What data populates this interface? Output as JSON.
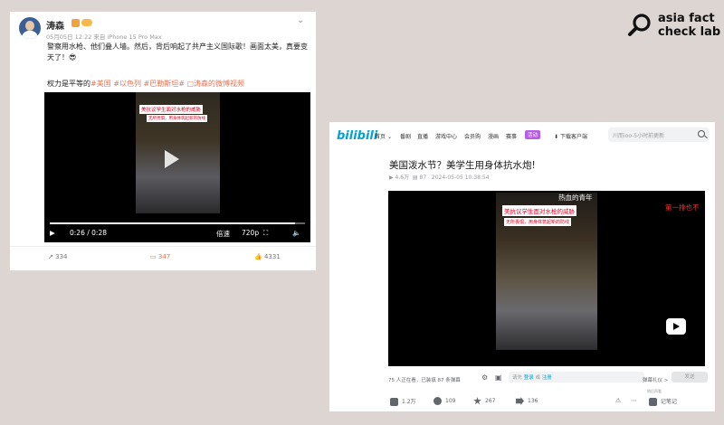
{
  "logo": {
    "line1": "asia fact",
    "line2": "check lab"
  },
  "weibo": {
    "username": "涛森",
    "meta": "05月05日 12:22 来自 iPhone 15 Pro Max",
    "text": "警察用水枪、他们叠人墙。然后，背后响起了共产主义国际歌！画面太美，真要变天了！😎",
    "lead": "权力是平等的",
    "tags": [
      "#美国",
      "#以色列",
      "#巴勒斯坦#",
      "涛森的微博视频"
    ],
    "video": {
      "caption1": "美抗议学生面对水枪的威胁",
      "caption2": "无所畏惧，用身体筑起新的防线",
      "current_time": "0:26",
      "total_time": "0:28",
      "separator": "/",
      "speed": "倍速",
      "quality": "720p",
      "progress": 0.96
    },
    "actions": {
      "share": "334",
      "comment": "347",
      "like": "4331"
    }
  },
  "bilibili": {
    "logo": "bilibili",
    "nav": [
      "首页",
      "番剧",
      "直播",
      "游戏中心",
      "会员购",
      "漫画",
      "赛事"
    ],
    "nav_highlight": "活动",
    "download": "下载客户端",
    "search_placeholder": "川而ioo-5小时前更新",
    "headline": "美国泼水节？美学生用身体抗水炮!",
    "stats": {
      "views": "4.6万",
      "danmaku": "87",
      "date": "2024-05-05 10:38:54"
    },
    "video": {
      "danmaku1": "热血的青年",
      "danmaku2": "第一排也不",
      "caption1": "美抗议学生面对水枪的威胁",
      "caption2": "无所畏惧，用身体筑起新的防线"
    },
    "bottom_bar": "75 人正在看，已装填 87 条弹幕",
    "danmaku_input": {
      "prefix": "请先",
      "login": "登录",
      "or": "或",
      "register": "注册"
    },
    "danmaku_etiquette": "弹幕礼仪 >",
    "send_label": "发送",
    "tiny_label": "稍后再看",
    "actions": {
      "like": "1.2万",
      "coin": "109",
      "favorite": "267",
      "share": "136",
      "note": "记笔记"
    }
  }
}
